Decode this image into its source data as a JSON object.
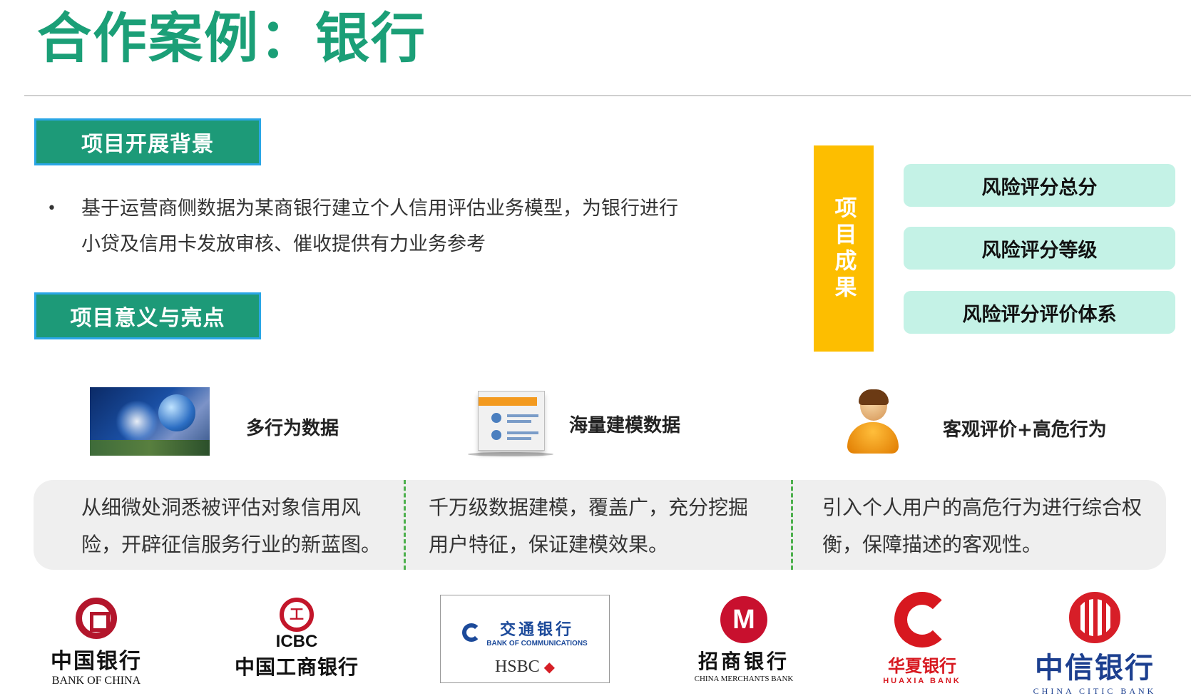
{
  "title": "合作案例：银行",
  "sections": {
    "background": {
      "label": "项目开展背景",
      "bullet": "•",
      "text": "基于运营商侧数据为某商银行建立个人信用评估业务模型，为银行进行小贷及信用卡发放审核、催收提供有力业务参考"
    },
    "significance": {
      "label": "项目意义与亮点"
    }
  },
  "results": {
    "label": "项目成果",
    "items": [
      "风险评分总分",
      "风险评分等级",
      "风险评分评价体系"
    ]
  },
  "features": [
    {
      "icon": "tech-network-image",
      "label": "多行为数据",
      "description": "从细微处洞悉被评估对象信用风险，开辟征信服务行业的新蓝图。"
    },
    {
      "icon": "document-users-icon",
      "label": "海量建模数据",
      "description": "千万级数据建模，覆盖广，充分挖掘用户特征，保证建模效果。"
    },
    {
      "icon": "user-person-icon",
      "label": "客观评价+高危行为",
      "description": "引入个人用户的高危行为进行综合权衡，保障描述的客观性。"
    }
  ],
  "bank_logos": {
    "boc": {
      "cn": "中国银行",
      "en": "BANK OF CHINA"
    },
    "icbc": {
      "en": "ICBC",
      "cn": "中国工商银行"
    },
    "bocom": {
      "cn": "交通银行",
      "en": "BANK OF COMMUNICATIONS",
      "partner": "HSBC"
    },
    "cmb": {
      "cn": "招商银行",
      "en": "CHINA MERCHANTS BANK"
    },
    "hxb": {
      "cn": "华夏银行",
      "en": "HUAXIA BANK"
    },
    "citic": {
      "cn": "中信银行",
      "en": "CHINA CITIC BANK"
    }
  },
  "colors": {
    "title_green": "#1b9f77",
    "tag_green": "#1d9a78",
    "tag_border_blue": "#2aa6e6",
    "results_yellow": "#fdbe00",
    "result_box_mint": "#c4f2e6",
    "divider_green": "#4db04d",
    "panel_gray": "#efefef"
  }
}
